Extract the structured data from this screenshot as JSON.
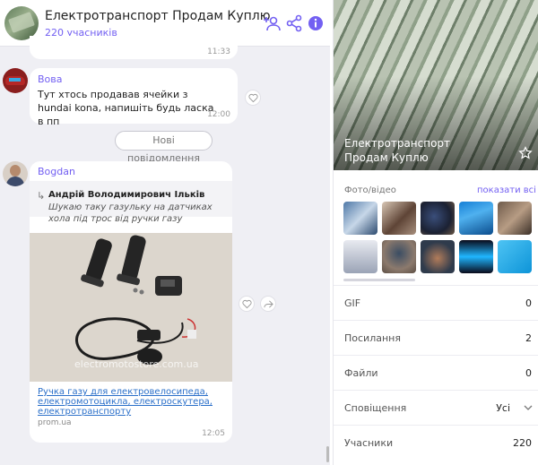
{
  "header": {
    "title": "Електротранспорт Продам Куплю",
    "subtitle": "220 учасників"
  },
  "messages": {
    "top": {
      "time": "11:33"
    },
    "vova": {
      "sender": "Вова",
      "text": "Тут хтось продавав ячейки з hundai kona, напишіть будь ласка в пп",
      "time": "12:00"
    },
    "new_messages_label": "Нові повідомлення",
    "bogdan": {
      "sender": "Bogdan",
      "reply_author": "Андрій Володимирович Ільків",
      "reply_text": "Шукаю таку газульку на датчиках хола під трос від ручки газу",
      "watermark": "electromotostore.com.ua",
      "link_title": "Ручка газу для електровелосипеда, електромотоцикла, електроскутера, електротранспорту",
      "link_domain": "prom.ua",
      "time": "12:05"
    }
  },
  "info": {
    "title": "Електротранспорт Продам Куплю",
    "media_label": "Фото/відео",
    "media_show_all": "показати всі",
    "rows": [
      {
        "label": "GIF",
        "value": "0"
      },
      {
        "label": "Посилання",
        "value": "2"
      },
      {
        "label": "Файли",
        "value": "0"
      },
      {
        "label": "Сповіщення",
        "value": "Усі"
      },
      {
        "label": "Учасники",
        "value": "220"
      }
    ]
  },
  "colors": {
    "accent": "#7360f2",
    "link": "#2a6fc9",
    "chat_bg": "#efeff4"
  },
  "icons": [
    "add-member-icon",
    "share-icon",
    "info-icon",
    "reply-arrow-icon",
    "heart-icon",
    "forward-icon",
    "star-icon",
    "chevron-down-icon"
  ]
}
